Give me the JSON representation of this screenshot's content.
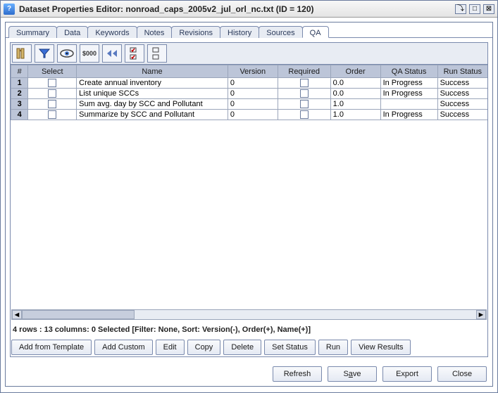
{
  "window": {
    "title": "Dataset Properties Editor: nonroad_caps_2005v2_jul_orl_nc.txt (ID = 120)"
  },
  "tabs": [
    "Summary",
    "Data",
    "Keywords",
    "Notes",
    "Revisions",
    "History",
    "Sources",
    "QA"
  ],
  "active_tab": "QA",
  "toolbar": {
    "icons": [
      "columns",
      "filter",
      "eye",
      "cost",
      "rewind",
      "check",
      "uncheck"
    ]
  },
  "table": {
    "headers": [
      "#",
      "Select",
      "Name",
      "Version",
      "Required",
      "Order",
      "QA Status",
      "Run Status"
    ],
    "rows": [
      {
        "num": "1",
        "select": false,
        "name": "Create annual inventory",
        "version": "0",
        "required": false,
        "order": "0.0",
        "qa_status": "In Progress",
        "run_status": "Success"
      },
      {
        "num": "2",
        "select": false,
        "name": "List unique SCCs",
        "version": "0",
        "required": false,
        "order": "0.0",
        "qa_status": "In Progress",
        "run_status": "Success"
      },
      {
        "num": "3",
        "select": false,
        "name": "Sum avg. day by SCC and Pollutant",
        "version": "0",
        "required": false,
        "order": "1.0",
        "qa_status": "",
        "run_status": "Success"
      },
      {
        "num": "4",
        "select": false,
        "name": "Summarize by SCC and Pollutant",
        "version": "0",
        "required": false,
        "order": "1.0",
        "qa_status": "In Progress",
        "run_status": "Success"
      }
    ]
  },
  "status_line": "4 rows : 13 columns: 0 Selected [Filter: None, Sort: Version(-), Order(+), Name(+)]",
  "qa_buttons": {
    "add_template": "Add from Template",
    "add_custom": "Add Custom",
    "edit": "Edit",
    "copy": "Copy",
    "delete": "Delete",
    "set_status": "Set Status",
    "run": "Run",
    "view_results": "View Results"
  },
  "bottom_buttons": {
    "refresh": "Refresh",
    "save_prefix": "S",
    "save_underline": "a",
    "save_suffix": "ve",
    "export": "Export",
    "close": "Close"
  }
}
